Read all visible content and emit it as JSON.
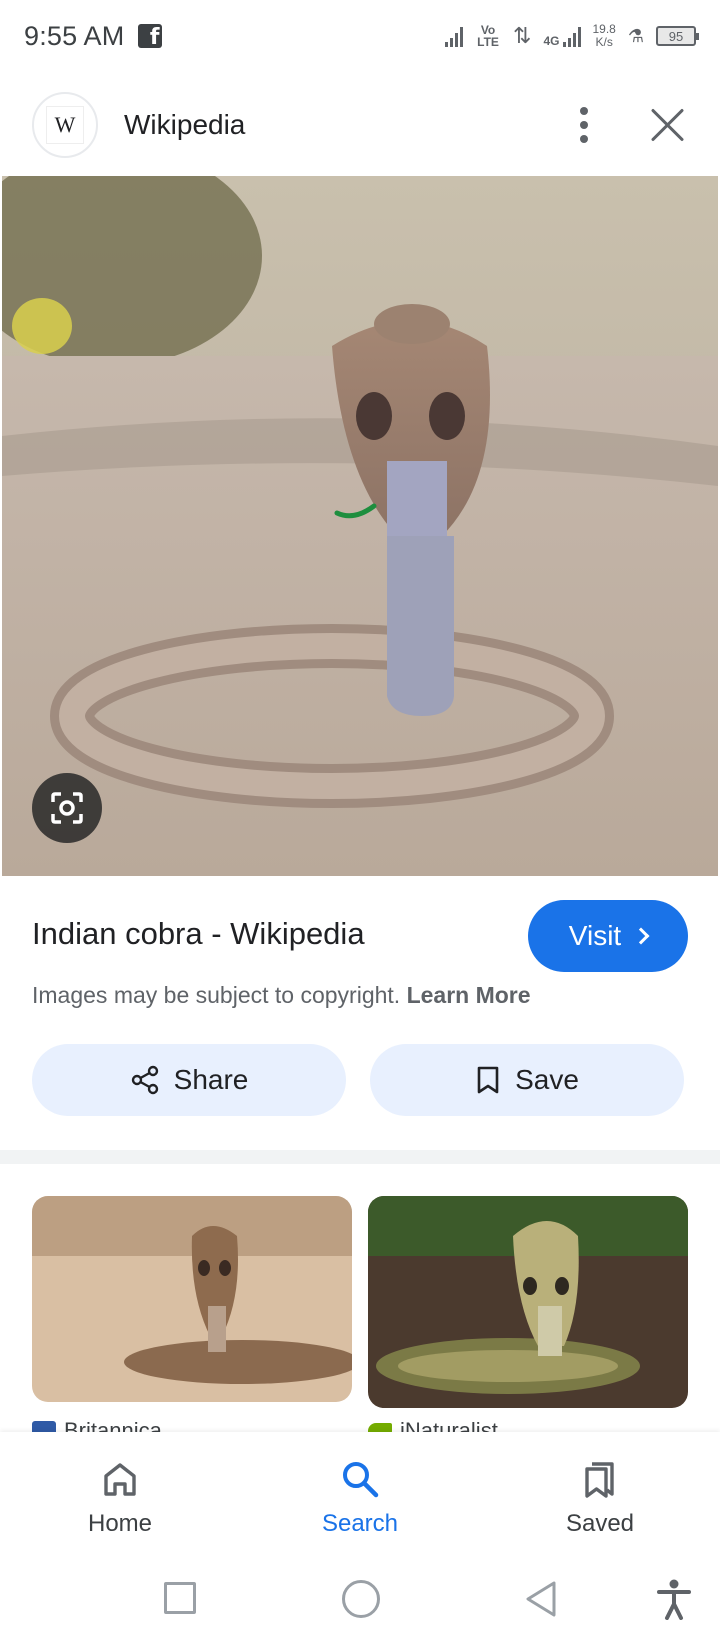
{
  "status_bar": {
    "time": "9:55 AM",
    "network_1": "Vo LTE",
    "network_2": "4G",
    "speed_value": "19.8",
    "speed_unit": "K/s",
    "battery": "95"
  },
  "header": {
    "site_logo_letter": "W",
    "site_name": "Wikipedia"
  },
  "result": {
    "title": "Indian cobra - Wikipedia",
    "visit_label": "Visit",
    "copyright_text": "Images may be subject to copyright.",
    "learn_more": "Learn More",
    "share_label": "Share",
    "save_label": "Save"
  },
  "related": [
    {
      "source": "Britannica"
    },
    {
      "source": "iNaturalist"
    }
  ],
  "bottom_nav": {
    "items": [
      {
        "label": "Home",
        "icon": "home-icon"
      },
      {
        "label": "Search",
        "icon": "search-icon"
      },
      {
        "label": "Saved",
        "icon": "saved-icon"
      }
    ],
    "active": "Search"
  },
  "colors": {
    "accent": "#1a73e8",
    "button_tint": "#e8f0fe"
  }
}
